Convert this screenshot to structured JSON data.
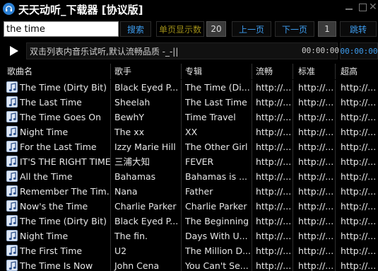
{
  "window": {
    "title": "天天动听_下载器 [协议版]",
    "close_glyph": "✕"
  },
  "toolbar": {
    "search_value": "the time",
    "search_label": "搜索",
    "per_page_label": "单页显示数",
    "per_page_value": "20",
    "prev_label": "上一页",
    "next_label": "下一页",
    "page_number": "1",
    "jump_label": "跳转"
  },
  "player": {
    "status_text": "双击列表内音乐试听,默认流畅品质  -_-||",
    "current_time": "00:00:00",
    "total_time": "00:00:00"
  },
  "table": {
    "columns": [
      "歌曲名",
      "歌手",
      "专辑",
      "流畅",
      "标准",
      "超高"
    ],
    "rows": [
      [
        "The Time (Dirty Bit)",
        "Black Eyed P...",
        "The Time (Di...",
        "http://...",
        "http://...",
        "http://..."
      ],
      [
        "The Last Time",
        "Sheelah",
        "The Last Time",
        "http://...",
        "http://...",
        "http://..."
      ],
      [
        "The Time Goes On",
        "BewhY",
        "Time Travel",
        "http://...",
        "http://...",
        "http://..."
      ],
      [
        "Night Time",
        "The xx",
        "XX",
        "http://...",
        "http://...",
        "http://..."
      ],
      [
        "For the Last Time",
        "Izzy Marie Hill",
        "The Other Girl",
        "http://...",
        "http://...",
        "http://..."
      ],
      [
        "IT'S THE RIGHT TIME",
        "三浦大知",
        "FEVER",
        "http://...",
        "http://...",
        "http://..."
      ],
      [
        "All the Time",
        "Bahamas",
        "Bahamas is ...",
        "http://...",
        "http://...",
        "http://..."
      ],
      [
        "Remember The Tim...",
        "Nana",
        "Father",
        "http://...",
        "http://...",
        "http://..."
      ],
      [
        "Now's the Time",
        "Charlie Parker",
        "Charlie Parker",
        "http://...",
        "http://...",
        "http://..."
      ],
      [
        "The Time (Dirty Bit)",
        "Black Eyed P...",
        "The Beginning",
        "http://...",
        "http://...",
        "http://..."
      ],
      [
        "Night Time",
        "The fin.",
        "Days With U...",
        "http://...",
        "http://...",
        "http://..."
      ],
      [
        "The First Time",
        "U2",
        "The Million D...",
        "http://...",
        "http://...",
        "http://..."
      ],
      [
        "The Time Is Now",
        "John Cena",
        "You Can't Se...",
        "http://...",
        "http://...",
        "http://..."
      ]
    ]
  },
  "colors": {
    "background": "#000000",
    "accent_blue": "#3d9df0",
    "label_gold": "#a09018"
  },
  "icons": {
    "app": "headphones-icon",
    "row": "music-note-icon",
    "play": "play-icon"
  }
}
